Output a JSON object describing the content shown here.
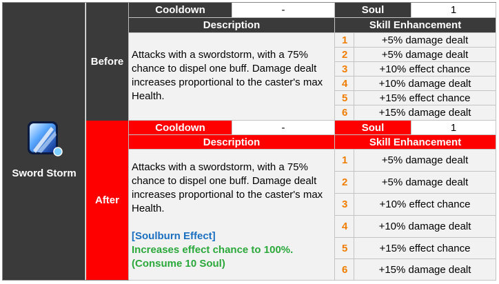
{
  "skill": {
    "name": "Sword Storm",
    "icon": "sword-storm-icon"
  },
  "labels": {
    "before": "Before",
    "after": "After"
  },
  "before": {
    "cooldown_label": "Cooldown",
    "cooldown_value": "-",
    "soul_label": "Soul",
    "soul_value": "1",
    "description_header": "Description",
    "enhancement_header": "Skill Enhancement",
    "description": "Attacks with a swordstorm, with a 75% chance to dispel one buff. Damage dealt increases proportional to the caster's max Health.",
    "enhancements": [
      {
        "num": "1",
        "text": "+5% damage dealt"
      },
      {
        "num": "2",
        "text": "+5% damage dealt"
      },
      {
        "num": "3",
        "text": "+10% effect chance"
      },
      {
        "num": "4",
        "text": "+10% damage dealt"
      },
      {
        "num": "5",
        "text": "+15% effect chance"
      },
      {
        "num": "6",
        "text": "+15% damage dealt"
      }
    ]
  },
  "after": {
    "cooldown_label": "Cooldown",
    "cooldown_value": "-",
    "soul_label": "Soul",
    "soul_value": "1",
    "description_header": "Description",
    "enhancement_header": "Skill Enhancement",
    "description": "Attacks with a swordstorm, with a 75% chance to dispel one buff. Damage dealt increases proportional to the caster's max Health.",
    "soulburn_title": "[Soulburn Effect]",
    "soulburn_line1": "Increases effect chance to 100%.",
    "soulburn_line2": "(Consume 10 Soul)",
    "enhancements": [
      {
        "num": "1",
        "text": "+5% damage dealt"
      },
      {
        "num": "2",
        "text": "+5% damage dealt"
      },
      {
        "num": "3",
        "text": "+10% effect chance"
      },
      {
        "num": "4",
        "text": "+10% damage dealt"
      },
      {
        "num": "5",
        "text": "+15% effect chance"
      },
      {
        "num": "6",
        "text": "+15% damage dealt"
      }
    ]
  },
  "colors": {
    "dark": "#3a3a3a",
    "red": "#ff0000",
    "number": "#f07d00",
    "soulburn_title": "#1a6fc0",
    "soulburn_text": "#2aa83a"
  }
}
